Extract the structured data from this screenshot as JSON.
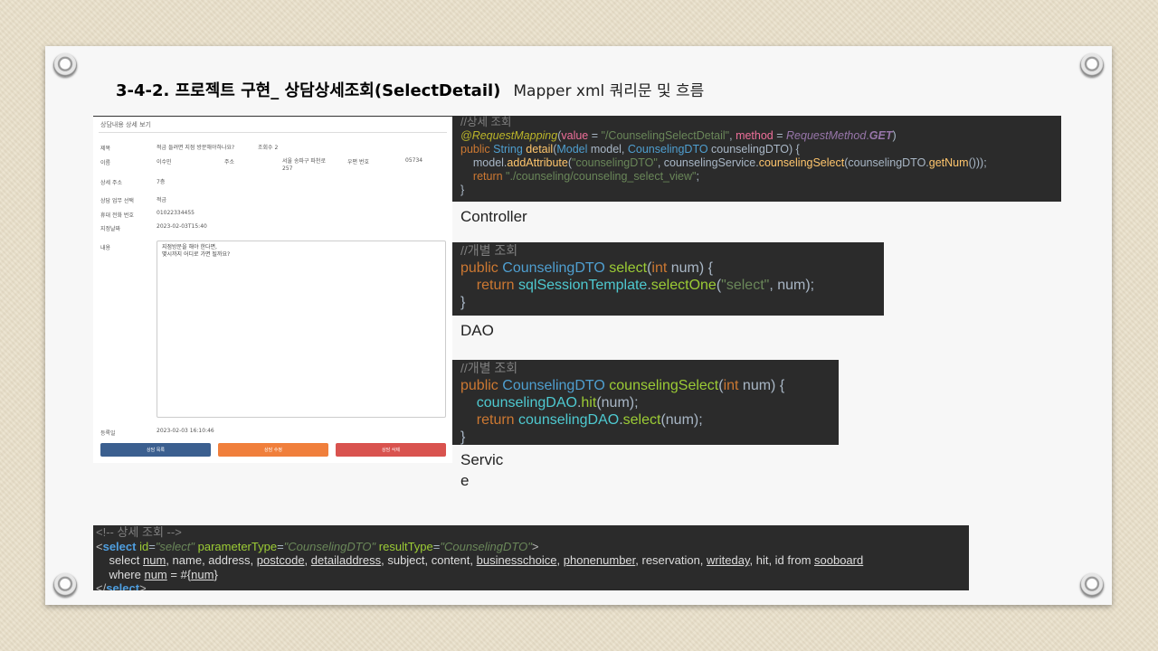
{
  "title": {
    "main": "3-4-2. 프로젝트 구현_ 상담상세조회(SelectDetail)",
    "sub": "Mapper xml 쿼리문 및 흐름"
  },
  "form": {
    "heading": "상담내용 상세 보기",
    "labels": [
      "제목",
      "이름",
      "상세 주소",
      "상담 업무 선택",
      "휴대 전화 번호",
      "지정날짜",
      "내용",
      "등록일"
    ],
    "subject": "적금 들려면 지점 방문해야하나요?",
    "hits": "조회수 2",
    "name": "이수민",
    "address_label": "주소",
    "address_line1": "서울 송파구 파천로",
    "address_line2": "257",
    "postcode_label": "우편 번호",
    "postcode": "05734",
    "detail_address": "7층",
    "business": "적금",
    "phone": "01022334455",
    "reservation": "2023-02-03T15:40",
    "content_line1": "지점방문을 해야 한다면,",
    "content_line2": "몇시까지 어디로 가면 될까요?",
    "writeday": "2023-02-03 16:10:46",
    "buttons": [
      "상담 목록",
      "상담 수정",
      "상담 삭제"
    ],
    "button_colors": [
      "#3b5f8f",
      "#f07f3c",
      "#d9534f"
    ]
  },
  "captions": {
    "controller": "Controller",
    "dao": "DAO",
    "service_1": "Servic",
    "service_2": "e"
  },
  "code": {
    "controller": [
      "//상세 조회",
      "@RequestMapping(value = \"/CounselingSelectDetail\", method = RequestMethod.GET)",
      "public String detail(Model model, CounselingDTO counselingDTO) {",
      "    model.addAttribute(\"counselingDTO\", counselingService.counselingSelect(counselingDTO.getNum()));",
      "    return \"./counseling/counseling_select_view\";",
      "}"
    ],
    "dao": [
      "//개별 조회",
      "public CounselingDTO select(int num) {",
      "    return sqlSessionTemplate.selectOne(\"select\", num);",
      "}"
    ],
    "service": [
      "//개별 조회",
      "public CounselingDTO counselingSelect(int num) {",
      "    counselingDAO.hit(num);",
      "    return counselingDAO.select(num);",
      "}"
    ],
    "mapper": [
      "<!-- 상세 조회 -->",
      "<select id=\"select\" parameterType=\"CounselingDTO\" resultType=\"CounselingDTO\">",
      "    select num, name, address, postcode, detailaddress, subject, content, businesschoice, phonenumber, reservation, writeday, hit, id from sooboard",
      "    where num = #{num}",
      "</select>"
    ]
  },
  "colors": {
    "background": "#e9dfc9",
    "slide": "#f7f7f7",
    "code_bg": "#2b2b2b"
  }
}
